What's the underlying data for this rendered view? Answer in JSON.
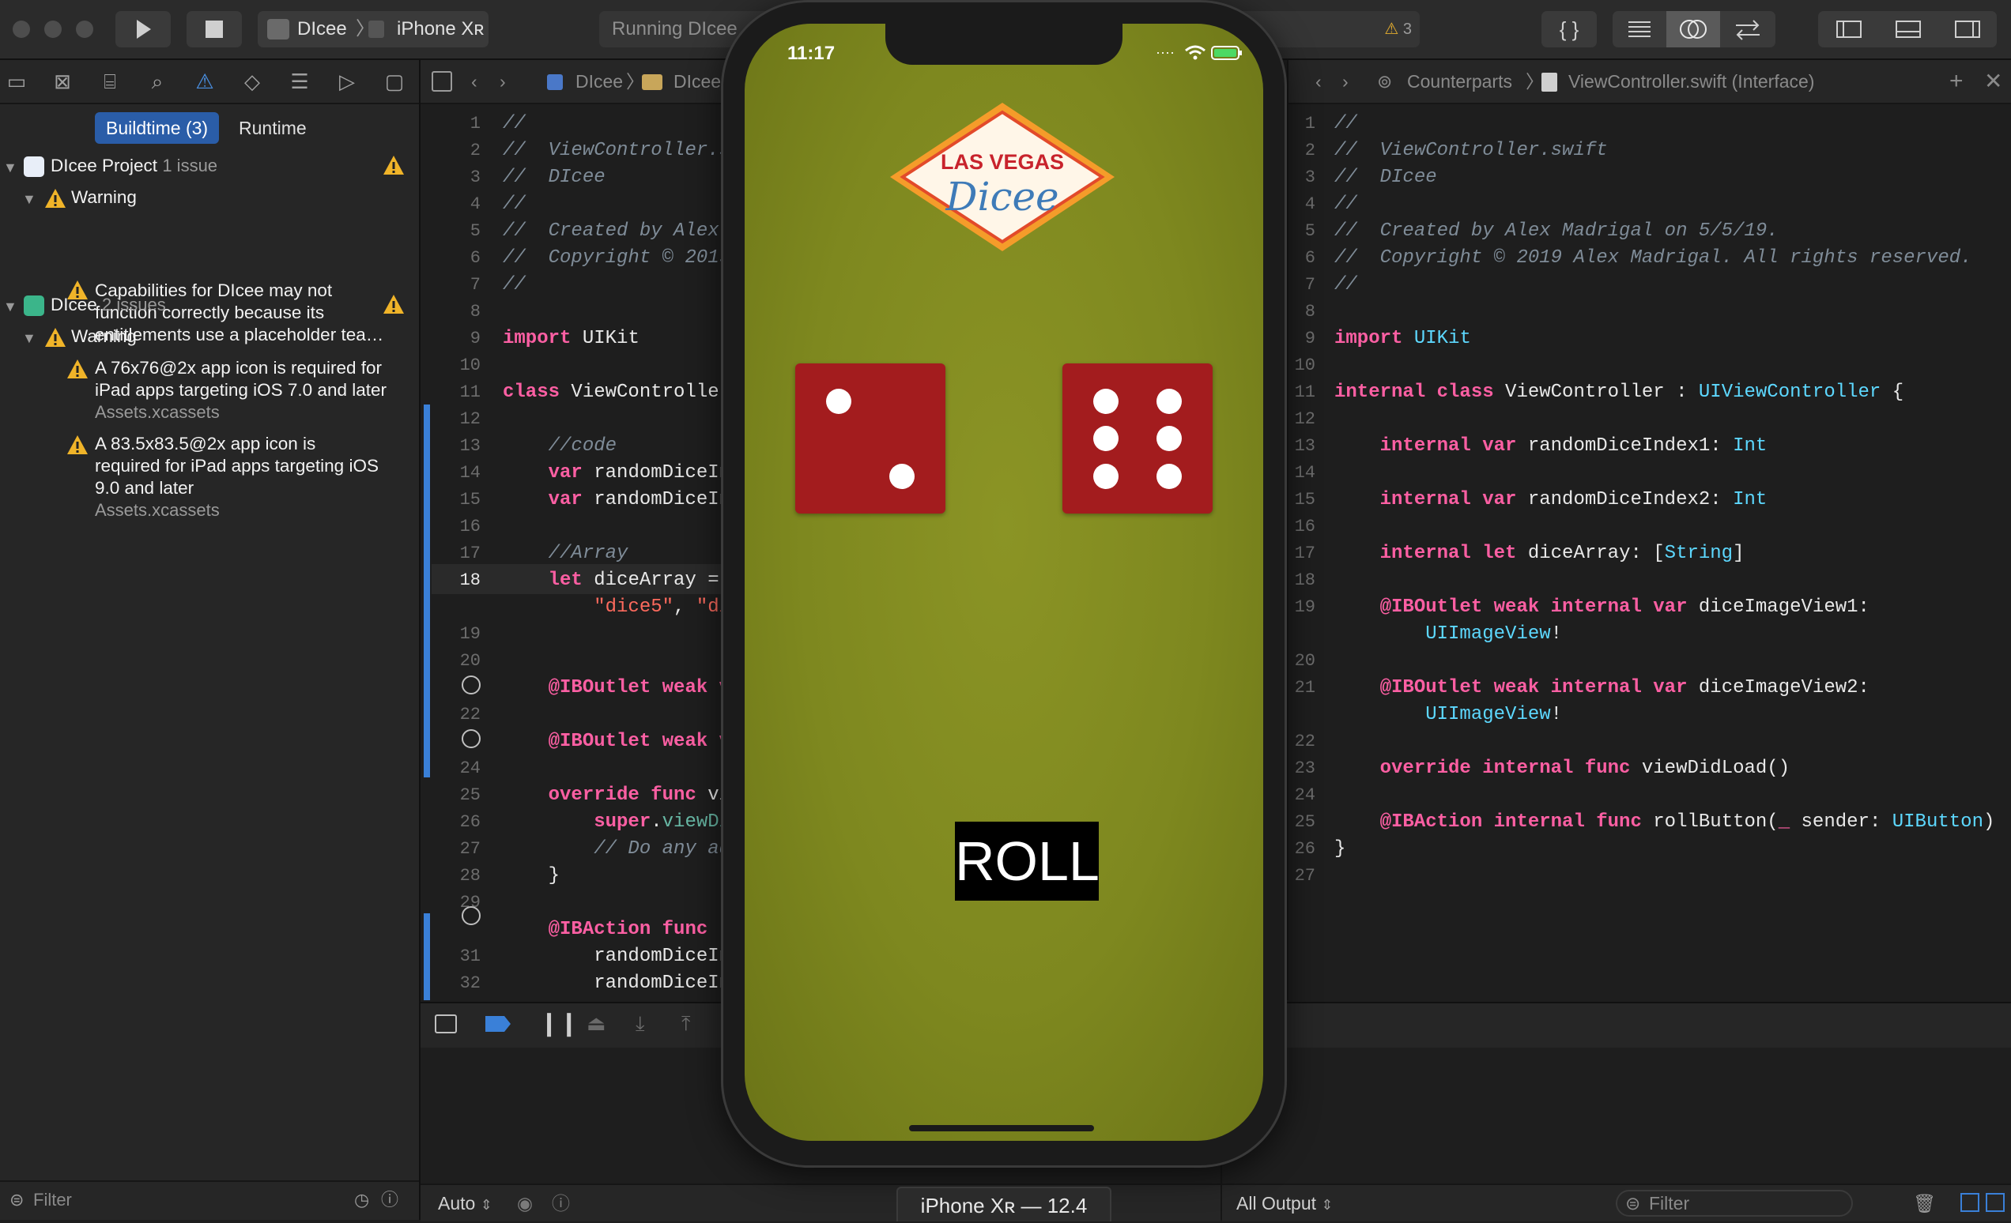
{
  "toolbar": {
    "scheme_app": "DIcee",
    "scheme_device": "iPhone Xʀ",
    "activity": "Running DIcee",
    "warning_count": "3"
  },
  "navigator": {
    "segments": [
      "Buildtime (3)",
      "Runtime"
    ],
    "groups": [
      {
        "name": "DIcee Project",
        "count": "1 issue",
        "category": "Warning",
        "issues": [
          {
            "text": [
              "Capabilities for DIcee may not",
              "function correctly because its",
              "entitlements use a placeholder tea…"
            ],
            "file": ""
          }
        ]
      },
      {
        "name": "DIcee",
        "count": "2 issues",
        "category": "Warning",
        "issues": [
          {
            "text": [
              "A 76x76@2x app icon is required for",
              "iPad apps targeting iOS 7.0 and later"
            ],
            "file": "Assets.xcassets"
          },
          {
            "text": [
              "A 83.5x83.5@2x app icon is",
              "required for iPad apps targeting iOS",
              "9.0 and later"
            ],
            "file": "Assets.xcassets"
          }
        ]
      }
    ],
    "filter_placeholder": "Filter"
  },
  "left_editor": {
    "jump": [
      "DIcee",
      "DIcee"
    ],
    "current_line": "18"
  },
  "right_editor": {
    "jump": [
      "Counterparts",
      "ViewController.swift (Interface)"
    ]
  },
  "bottom": {
    "auto": "Auto",
    "all_output": "All Output",
    "filter_placeholder": "Filter"
  },
  "simulator": {
    "time": "11:17",
    "logo_top": "LAS VEGAS",
    "logo_bottom": "Dicee",
    "roll_label": "ROLL",
    "device_label": "iPhone Xʀ — 12.4",
    "left_die": 2,
    "right_die": 6
  },
  "colors": {
    "accent": "#2a5da8",
    "felt": "#808a20",
    "die": "#a31c1e",
    "keyword": "#fc5fa3",
    "comment": "#7f8c98",
    "type": "#5dd8ff"
  }
}
